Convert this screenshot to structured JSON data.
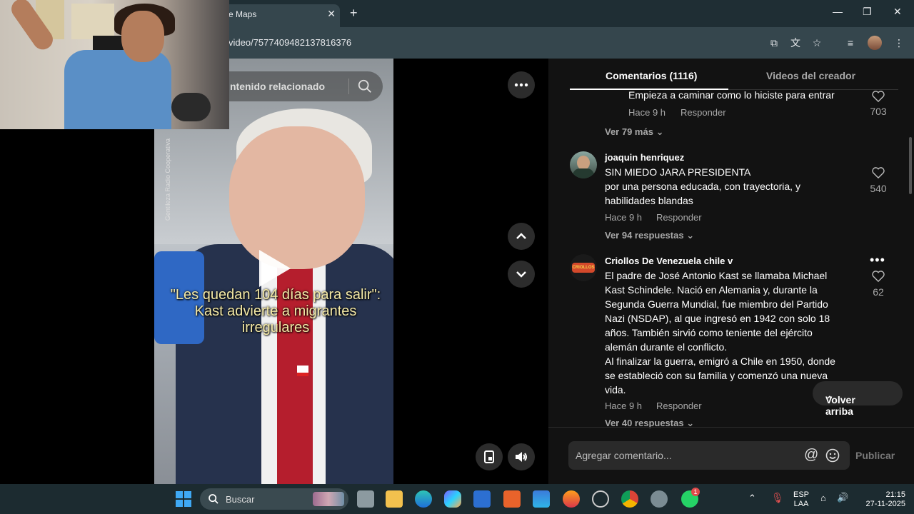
{
  "browser": {
    "tab_title": "e Maps",
    "url": "video/7577409482137816376"
  },
  "video": {
    "search_placeholder": "ntenido relacionado",
    "caption": "\"Les quedan 104 días para salir\": Kast advierte a migrantes irregulares",
    "credit": "Gentileza Radio Cooperativa"
  },
  "comments_panel": {
    "tab_comments": "Comentarios (1116)",
    "tab_videos": "Videos del creador",
    "comments": [
      {
        "text": "Empieza a caminar como lo hiciste para entrar",
        "time": "Hace 9 h",
        "reply": "Responder",
        "likes": "703",
        "more_replies": "Ver 79 más"
      },
      {
        "user": "joaquin henriquez",
        "lines": [
          "SIN MIEDO JARA PRESIDENTA",
          "por una persona educada, con trayectoria, y",
          "habilidades blandas"
        ],
        "time": "Hace 9 h",
        "reply": "Responder",
        "likes": "540",
        "more_replies": "Ver 94 respuestas"
      },
      {
        "user": "Criollos De Venezuela chile v",
        "avatar_text": "CRIOLLOS",
        "lines": [
          "El padre de José Antonio Kast se llamaba Michael",
          "Kast Schindele. Nació en Alemania y, durante la",
          "Segunda Guerra Mundial, fue miembro del Partido",
          "Nazi (NSDAP), al que ingresó en 1942 con solo 18",
          "años. También sirvió como teniente del ejército",
          "alemán durante el conflicto.",
          "Al finalizar la guerra, emigró a Chile en 1950, donde",
          "se estableció con su familia y comenzó una nueva",
          "vida."
        ],
        "time": "Hace 9 h",
        "reply": "Responder",
        "likes": "62",
        "more_replies": "Ver 40 respuestas"
      }
    ],
    "volver_arriba": "Volver arriba",
    "comment_placeholder": "Agregar comentario...",
    "publish": "Publicar"
  },
  "taskbar": {
    "search": "Buscar",
    "lang_top": "ESP",
    "lang_bottom": "LAA",
    "time": "21:15",
    "date": "27-11-2025",
    "whatsapp_badge": "1"
  }
}
